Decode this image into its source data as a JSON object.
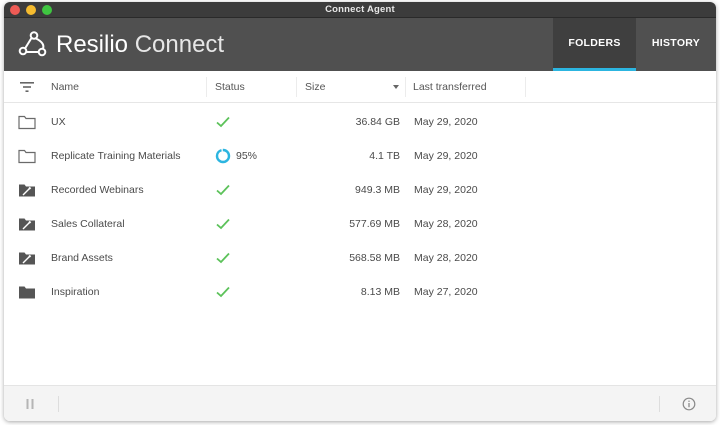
{
  "window": {
    "title": "Connect Agent"
  },
  "header": {
    "brand_first": "Resilio",
    "brand_second": "Connect",
    "tabs": [
      {
        "label": "FOLDERS",
        "active": true
      },
      {
        "label": "HISTORY",
        "active": false
      }
    ]
  },
  "columns": {
    "name": "Name",
    "status": "Status",
    "size": "Size",
    "last_transferred": "Last transferred"
  },
  "folders": [
    {
      "name": "UX",
      "status": "synced",
      "size": "36.84 GB",
      "last_transferred": "May 29, 2020",
      "icon": "folder-outline-icon"
    },
    {
      "name": "Replicate Training Materials",
      "status": "syncing",
      "progress_label": "95%",
      "progress": 0.95,
      "size": "4.1 TB",
      "last_transferred": "May 29, 2020",
      "icon": "folder-outline-icon"
    },
    {
      "name": "Recorded Webinars",
      "status": "synced",
      "size": "949.3 MB",
      "last_transferred": "May 29, 2020",
      "icon": "folder-readonly-icon"
    },
    {
      "name": "Sales Collateral",
      "status": "synced",
      "size": "577.69 MB",
      "last_transferred": "May 28, 2020",
      "icon": "folder-readonly-icon"
    },
    {
      "name": "Brand Assets",
      "status": "synced",
      "size": "568.58 MB",
      "last_transferred": "May 28, 2020",
      "icon": "folder-readonly-icon"
    },
    {
      "name": "Inspiration",
      "status": "synced",
      "size": "8.13 MB",
      "last_transferred": "May 27, 2020",
      "icon": "folder-filled-icon"
    }
  ],
  "colors": {
    "header_bg": "#505050",
    "tab_active_bg": "#3f3f3f",
    "accent": "#2cb5e0",
    "check": "#5cc25a"
  }
}
